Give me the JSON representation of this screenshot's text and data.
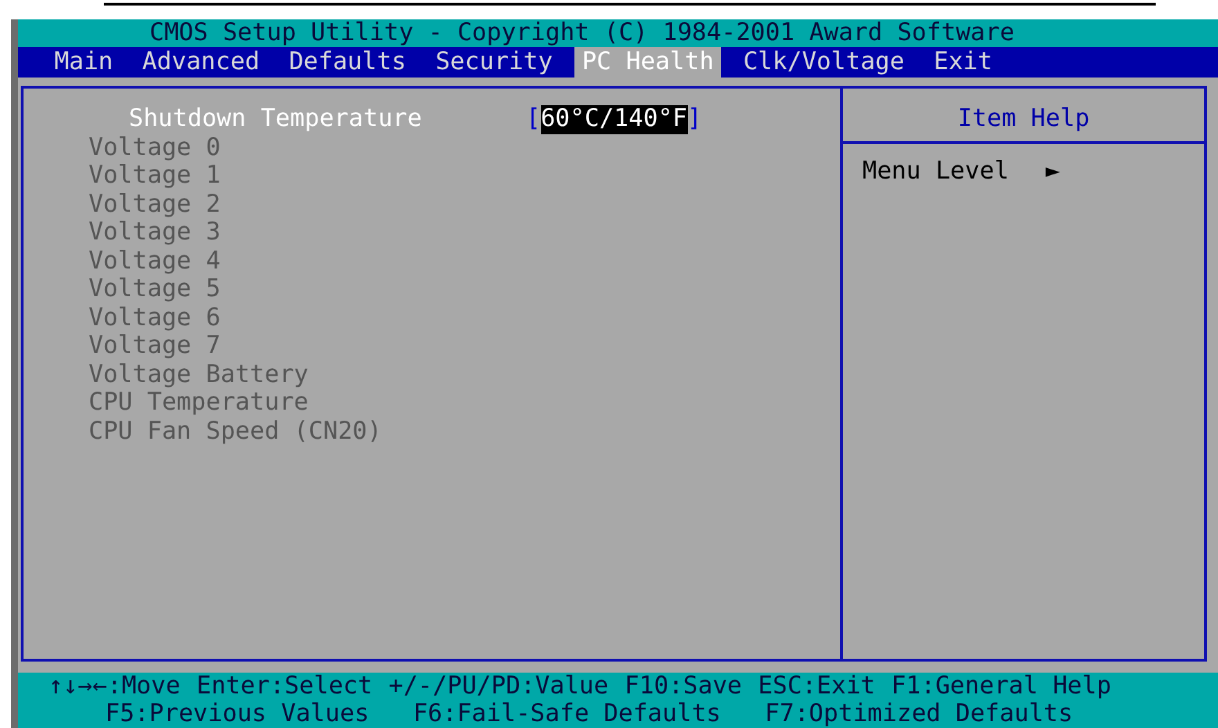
{
  "window": {
    "title": "CMOS Setup Utility - Copyright (C) 1984-2001 Award Software"
  },
  "tabs": [
    {
      "label": "Main",
      "selected": false
    },
    {
      "label": "Advanced",
      "selected": false
    },
    {
      "label": "Defaults",
      "selected": false
    },
    {
      "label": "Security",
      "selected": false
    },
    {
      "label": "PC Health",
      "selected": true
    },
    {
      "label": "Clk/Voltage",
      "selected": false
    },
    {
      "label": "Exit",
      "selected": false
    }
  ],
  "settings": [
    {
      "label": "Shutdown Temperature",
      "value": "60°C/140°F",
      "value_brackets": [
        "[",
        "]"
      ],
      "disabled": false,
      "selected": true
    },
    {
      "label": "Voltage 0",
      "disabled": true
    },
    {
      "label": "Voltage 1",
      "disabled": true
    },
    {
      "label": "Voltage 2",
      "disabled": true
    },
    {
      "label": "Voltage 3",
      "disabled": true
    },
    {
      "label": "Voltage 4",
      "disabled": true
    },
    {
      "label": "Voltage 5",
      "disabled": true
    },
    {
      "label": "Voltage 6",
      "disabled": true
    },
    {
      "label": "Voltage 7",
      "disabled": true
    },
    {
      "label": "Voltage Battery",
      "disabled": true
    },
    {
      "label": "CPU Temperature",
      "disabled": true
    },
    {
      "label": "CPU Fan Speed (CN20)",
      "disabled": true
    }
  ],
  "help": {
    "title": "Item Help",
    "menu_level_label": "Menu Level",
    "menu_level_marker": "►"
  },
  "key_hints": [
    [
      "↑↓→←:Move",
      "Enter:Select",
      "+/-/PU/PD:Value",
      "F10:Save",
      "ESC:Exit",
      "F1:General Help"
    ],
    [
      "F5:Previous Values",
      "F6:Fail-Safe Defaults",
      "F7:Optimized Defaults"
    ]
  ]
}
